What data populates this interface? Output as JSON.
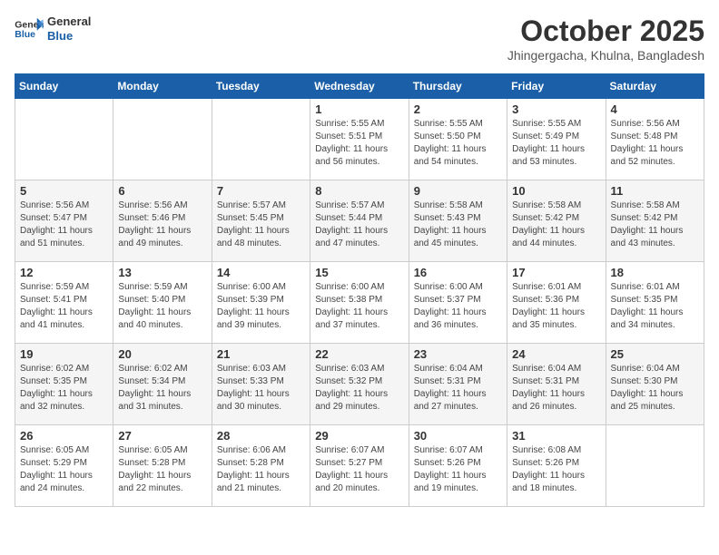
{
  "header": {
    "logo_line1": "General",
    "logo_line2": "Blue",
    "month": "October 2025",
    "location": "Jhingergacha, Khulna, Bangladesh"
  },
  "weekdays": [
    "Sunday",
    "Monday",
    "Tuesday",
    "Wednesday",
    "Thursday",
    "Friday",
    "Saturday"
  ],
  "weeks": [
    [
      {
        "day": "",
        "sunrise": "",
        "sunset": "",
        "daylight": ""
      },
      {
        "day": "",
        "sunrise": "",
        "sunset": "",
        "daylight": ""
      },
      {
        "day": "",
        "sunrise": "",
        "sunset": "",
        "daylight": ""
      },
      {
        "day": "1",
        "sunrise": "Sunrise: 5:55 AM",
        "sunset": "Sunset: 5:51 PM",
        "daylight": "Daylight: 11 hours and 56 minutes."
      },
      {
        "day": "2",
        "sunrise": "Sunrise: 5:55 AM",
        "sunset": "Sunset: 5:50 PM",
        "daylight": "Daylight: 11 hours and 54 minutes."
      },
      {
        "day": "3",
        "sunrise": "Sunrise: 5:55 AM",
        "sunset": "Sunset: 5:49 PM",
        "daylight": "Daylight: 11 hours and 53 minutes."
      },
      {
        "day": "4",
        "sunrise": "Sunrise: 5:56 AM",
        "sunset": "Sunset: 5:48 PM",
        "daylight": "Daylight: 11 hours and 52 minutes."
      }
    ],
    [
      {
        "day": "5",
        "sunrise": "Sunrise: 5:56 AM",
        "sunset": "Sunset: 5:47 PM",
        "daylight": "Daylight: 11 hours and 51 minutes."
      },
      {
        "day": "6",
        "sunrise": "Sunrise: 5:56 AM",
        "sunset": "Sunset: 5:46 PM",
        "daylight": "Daylight: 11 hours and 49 minutes."
      },
      {
        "day": "7",
        "sunrise": "Sunrise: 5:57 AM",
        "sunset": "Sunset: 5:45 PM",
        "daylight": "Daylight: 11 hours and 48 minutes."
      },
      {
        "day": "8",
        "sunrise": "Sunrise: 5:57 AM",
        "sunset": "Sunset: 5:44 PM",
        "daylight": "Daylight: 11 hours and 47 minutes."
      },
      {
        "day": "9",
        "sunrise": "Sunrise: 5:58 AM",
        "sunset": "Sunset: 5:43 PM",
        "daylight": "Daylight: 11 hours and 45 minutes."
      },
      {
        "day": "10",
        "sunrise": "Sunrise: 5:58 AM",
        "sunset": "Sunset: 5:42 PM",
        "daylight": "Daylight: 11 hours and 44 minutes."
      },
      {
        "day": "11",
        "sunrise": "Sunrise: 5:58 AM",
        "sunset": "Sunset: 5:42 PM",
        "daylight": "Daylight: 11 hours and 43 minutes."
      }
    ],
    [
      {
        "day": "12",
        "sunrise": "Sunrise: 5:59 AM",
        "sunset": "Sunset: 5:41 PM",
        "daylight": "Daylight: 11 hours and 41 minutes."
      },
      {
        "day": "13",
        "sunrise": "Sunrise: 5:59 AM",
        "sunset": "Sunset: 5:40 PM",
        "daylight": "Daylight: 11 hours and 40 minutes."
      },
      {
        "day": "14",
        "sunrise": "Sunrise: 6:00 AM",
        "sunset": "Sunset: 5:39 PM",
        "daylight": "Daylight: 11 hours and 39 minutes."
      },
      {
        "day": "15",
        "sunrise": "Sunrise: 6:00 AM",
        "sunset": "Sunset: 5:38 PM",
        "daylight": "Daylight: 11 hours and 37 minutes."
      },
      {
        "day": "16",
        "sunrise": "Sunrise: 6:00 AM",
        "sunset": "Sunset: 5:37 PM",
        "daylight": "Daylight: 11 hours and 36 minutes."
      },
      {
        "day": "17",
        "sunrise": "Sunrise: 6:01 AM",
        "sunset": "Sunset: 5:36 PM",
        "daylight": "Daylight: 11 hours and 35 minutes."
      },
      {
        "day": "18",
        "sunrise": "Sunrise: 6:01 AM",
        "sunset": "Sunset: 5:35 PM",
        "daylight": "Daylight: 11 hours and 34 minutes."
      }
    ],
    [
      {
        "day": "19",
        "sunrise": "Sunrise: 6:02 AM",
        "sunset": "Sunset: 5:35 PM",
        "daylight": "Daylight: 11 hours and 32 minutes."
      },
      {
        "day": "20",
        "sunrise": "Sunrise: 6:02 AM",
        "sunset": "Sunset: 5:34 PM",
        "daylight": "Daylight: 11 hours and 31 minutes."
      },
      {
        "day": "21",
        "sunrise": "Sunrise: 6:03 AM",
        "sunset": "Sunset: 5:33 PM",
        "daylight": "Daylight: 11 hours and 30 minutes."
      },
      {
        "day": "22",
        "sunrise": "Sunrise: 6:03 AM",
        "sunset": "Sunset: 5:32 PM",
        "daylight": "Daylight: 11 hours and 29 minutes."
      },
      {
        "day": "23",
        "sunrise": "Sunrise: 6:04 AM",
        "sunset": "Sunset: 5:31 PM",
        "daylight": "Daylight: 11 hours and 27 minutes."
      },
      {
        "day": "24",
        "sunrise": "Sunrise: 6:04 AM",
        "sunset": "Sunset: 5:31 PM",
        "daylight": "Daylight: 11 hours and 26 minutes."
      },
      {
        "day": "25",
        "sunrise": "Sunrise: 6:04 AM",
        "sunset": "Sunset: 5:30 PM",
        "daylight": "Daylight: 11 hours and 25 minutes."
      }
    ],
    [
      {
        "day": "26",
        "sunrise": "Sunrise: 6:05 AM",
        "sunset": "Sunset: 5:29 PM",
        "daylight": "Daylight: 11 hours and 24 minutes."
      },
      {
        "day": "27",
        "sunrise": "Sunrise: 6:05 AM",
        "sunset": "Sunset: 5:28 PM",
        "daylight": "Daylight: 11 hours and 22 minutes."
      },
      {
        "day": "28",
        "sunrise": "Sunrise: 6:06 AM",
        "sunset": "Sunset: 5:28 PM",
        "daylight": "Daylight: 11 hours and 21 minutes."
      },
      {
        "day": "29",
        "sunrise": "Sunrise: 6:07 AM",
        "sunset": "Sunset: 5:27 PM",
        "daylight": "Daylight: 11 hours and 20 minutes."
      },
      {
        "day": "30",
        "sunrise": "Sunrise: 6:07 AM",
        "sunset": "Sunset: 5:26 PM",
        "daylight": "Daylight: 11 hours and 19 minutes."
      },
      {
        "day": "31",
        "sunrise": "Sunrise: 6:08 AM",
        "sunset": "Sunset: 5:26 PM",
        "daylight": "Daylight: 11 hours and 18 minutes."
      },
      {
        "day": "",
        "sunrise": "",
        "sunset": "",
        "daylight": ""
      }
    ]
  ]
}
